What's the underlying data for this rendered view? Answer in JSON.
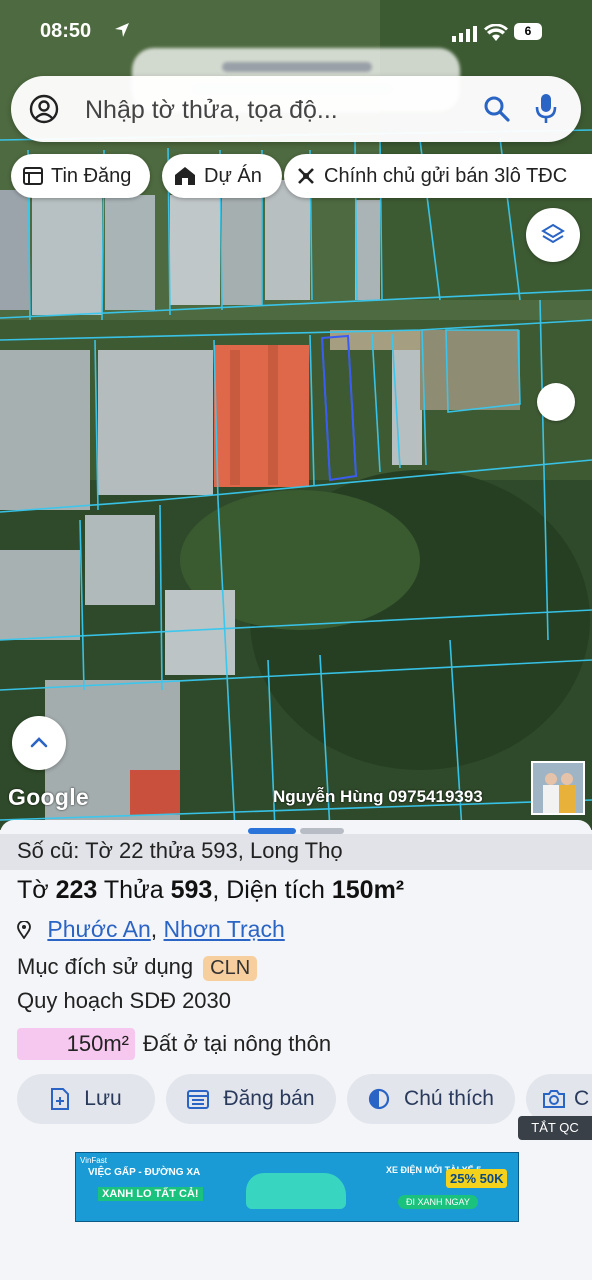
{
  "status_bar": {
    "time": "08:50",
    "battery": "6"
  },
  "search": {
    "placeholder": "Nhập tờ thửa, tọa độ..."
  },
  "chips": [
    {
      "label": "Tin Đăng",
      "icon": "listing-icon"
    },
    {
      "label": "Dự Án",
      "icon": "project-icon"
    },
    {
      "label": "Chính chủ gửi bán 3lô TĐC",
      "icon": "ad-icon"
    }
  ],
  "map": {
    "attribution": "Google",
    "owner_label": "Nguyễn Hùng 0975419393"
  },
  "sheet": {
    "old_ref": "Số cũ: Tờ 22 thửa 593, Long Thọ",
    "title": {
      "to_label": "Tờ",
      "to_value": "223",
      "thua_label": "Thửa",
      "thua_value": "593",
      "area_label": ", Diện tích",
      "area_value": "150m²"
    },
    "address": {
      "ward": "Phước An",
      "separator": ",",
      "district": "Nhơn Trạch"
    },
    "purpose_label": "Mục đích sử dụng",
    "purpose_code": "CLN",
    "plan_label": "Quy hoạch SDĐ 2030",
    "area_box_value": "150m²",
    "area_box_desc": "Đất ở tại nông thôn",
    "area_box_color": "#f6c8ef",
    "actions": [
      {
        "label": "Lưu",
        "icon": "save-icon"
      },
      {
        "label": "Đăng bán",
        "icon": "post-sale-icon"
      },
      {
        "label": "Chú thích",
        "icon": "legend-icon"
      },
      {
        "label": "C",
        "icon": "camera-icon"
      }
    ],
    "ads_tag": "TẮT QC"
  },
  "banner": {
    "logo": "VinFast",
    "line1": "VIỆC GẤP - ĐƯỜNG XA",
    "line2": "XANH LO TẤT CẢ!",
    "line3": "XE ĐIỆN MỚI TÀI XẾ 5",
    "discount": "25% 50K",
    "cta": "ĐI XANH NGAY"
  },
  "colors": {
    "accent": "#2a64c4",
    "parcel_line": "#38c8f0",
    "badge": "#f7cf9e"
  }
}
